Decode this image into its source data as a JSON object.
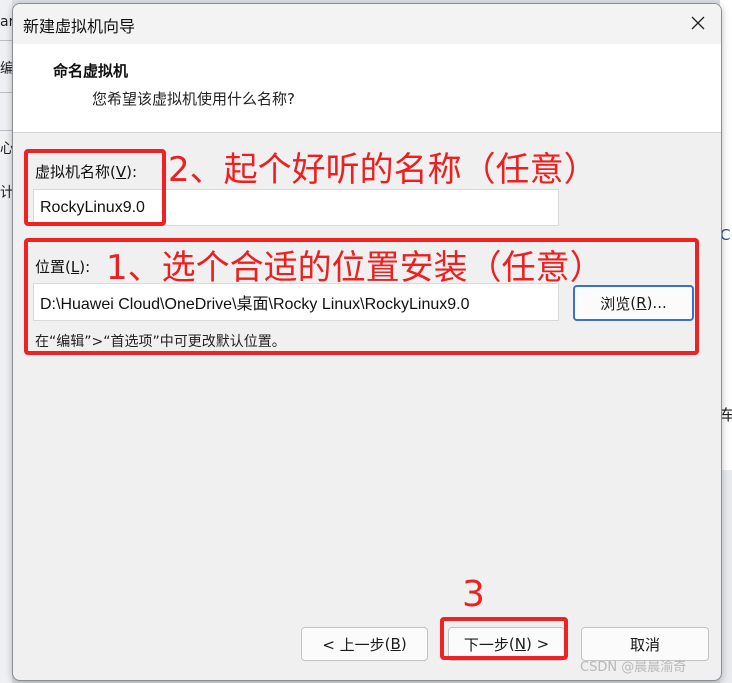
{
  "dialog": {
    "title": "新建虚拟机向导",
    "header_title": "命名虚拟机",
    "header_subtitle": "您希望该虚拟机使用什么名称?"
  },
  "fields": {
    "vm_name_label": "虚拟机名称",
    "vm_name_hotkey": "V",
    "vm_name_value": "RockyLinux9.0",
    "location_label": "位置",
    "location_hotkey": "L",
    "location_value": "D:\\Huawei Cloud\\OneDrive\\桌面\\Rocky Linux\\RockyLinux9.0",
    "browse_label": "浏览",
    "browse_hotkey": "R",
    "hint": "在“编辑”>“首选项”中可更改默认位置。"
  },
  "buttons": {
    "back_label": "< 上一步",
    "back_hotkey": "B",
    "next_label": "下一步",
    "next_hotkey": "N",
    "cancel": "取消"
  },
  "annotations": {
    "step1": "1、选个合适的位置安装（任意）",
    "step2": "2、起个好听的名称（任意）",
    "step3": "3"
  },
  "background_fragments": {
    "left": [
      "ar",
      "编",
      "心",
      "计"
    ],
    "right": [
      "C",
      "车"
    ]
  },
  "watermark": "CSDN @晨晨渝奇",
  "colors": {
    "annotation_red": "#ee2222",
    "focus_blue": "#3b6fd1"
  }
}
